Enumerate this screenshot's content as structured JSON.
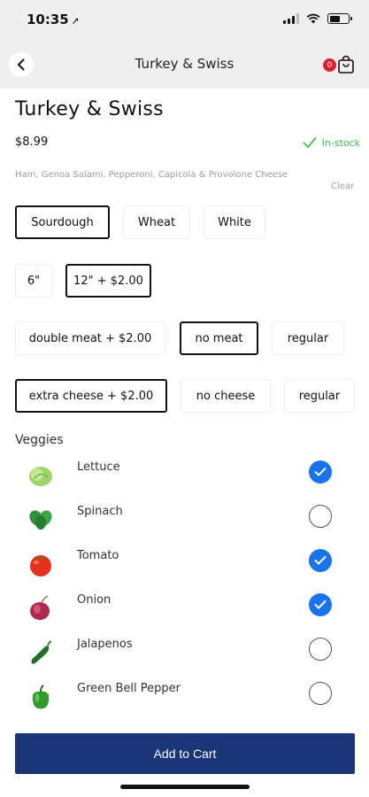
{
  "status": {
    "time": "10:35"
  },
  "nav": {
    "title": "Turkey & Swiss",
    "cart_count": "0"
  },
  "product": {
    "title": "Turkey & Swiss",
    "price": "$8.99",
    "stock": "In-stock",
    "description": "Ham, Genoa Salami, Pepperoni, Capicola & Provolone Cheese",
    "clear_label": "Clear"
  },
  "bread": {
    "options": [
      "Sourdough",
      "Wheat",
      "White"
    ],
    "selected": "Sourdough"
  },
  "size": {
    "options": [
      "6\"",
      "12\" + $2.00"
    ],
    "selected": "12\" + $2.00"
  },
  "meat": {
    "options": [
      "double meat + $2.00",
      "no meat",
      "regular"
    ],
    "selected": "no meat"
  },
  "cheese": {
    "options": [
      "extra cheese + $2.00",
      "no cheese",
      "regular"
    ],
    "selected": "extra cheese + $2.00"
  },
  "veggies": {
    "label": "Veggies",
    "items": [
      {
        "name": "Lettuce",
        "checked": true,
        "icon": "lettuce-icon"
      },
      {
        "name": "Spinach",
        "checked": false,
        "icon": "spinach-icon"
      },
      {
        "name": "Tomato",
        "checked": true,
        "icon": "tomato-icon"
      },
      {
        "name": "Onion",
        "checked": true,
        "icon": "onion-icon"
      },
      {
        "name": "Jalapenos",
        "checked": false,
        "icon": "jalapeno-icon"
      },
      {
        "name": "Green Bell Pepper",
        "checked": false,
        "icon": "bell-pepper-icon"
      }
    ]
  },
  "add_to_cart": {
    "label": "Add to Cart"
  },
  "colors": {
    "accent_blue": "#1a73e8",
    "button_navy": "#1a3578",
    "in_stock_green": "#3dbd5a",
    "badge_red": "#e0202a"
  }
}
